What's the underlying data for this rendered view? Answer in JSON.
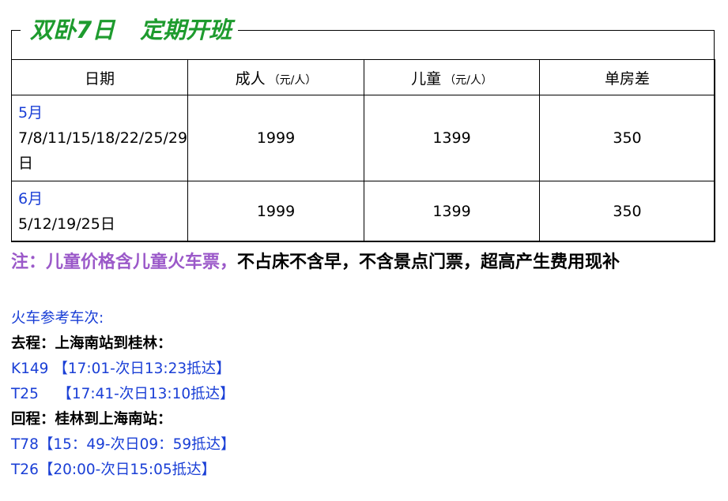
{
  "title": {
    "part1": "双卧7日",
    "part2": "定期开班"
  },
  "table": {
    "headers": [
      {
        "label": "日期",
        "unit": ""
      },
      {
        "label": "成人",
        "unit": "（元/人）"
      },
      {
        "label": "儿童",
        "unit": "（元/人）"
      },
      {
        "label": "单房差",
        "unit": ""
      }
    ],
    "rows": [
      {
        "month": "5月",
        "dates": "7/8/11/15/18/22/25/29日",
        "adult": "1999",
        "child": "1399",
        "single": "350"
      },
      {
        "month": "6月",
        "dates": "5/12/19/25日",
        "adult": "1999",
        "child": "1399",
        "single": "350"
      }
    ]
  },
  "note": {
    "highlight": "注：儿童价格含儿童火车票，",
    "rest": "不占床不含早，不含景点门票，超高产生费用现补"
  },
  "train": {
    "heading": "火车参考车次:",
    "outbound_label": "去程：上海南站到桂林：",
    "outbound": [
      "K149 【17:01-次日13:23抵达】",
      "T25    【17:41-次日13:10抵达】"
    ],
    "return_label": "回程：桂林到上海南站：",
    "return": [
      "T78【15：49-次日09：59抵达】",
      "T26【20:00-次日15:05抵达】"
    ]
  }
}
